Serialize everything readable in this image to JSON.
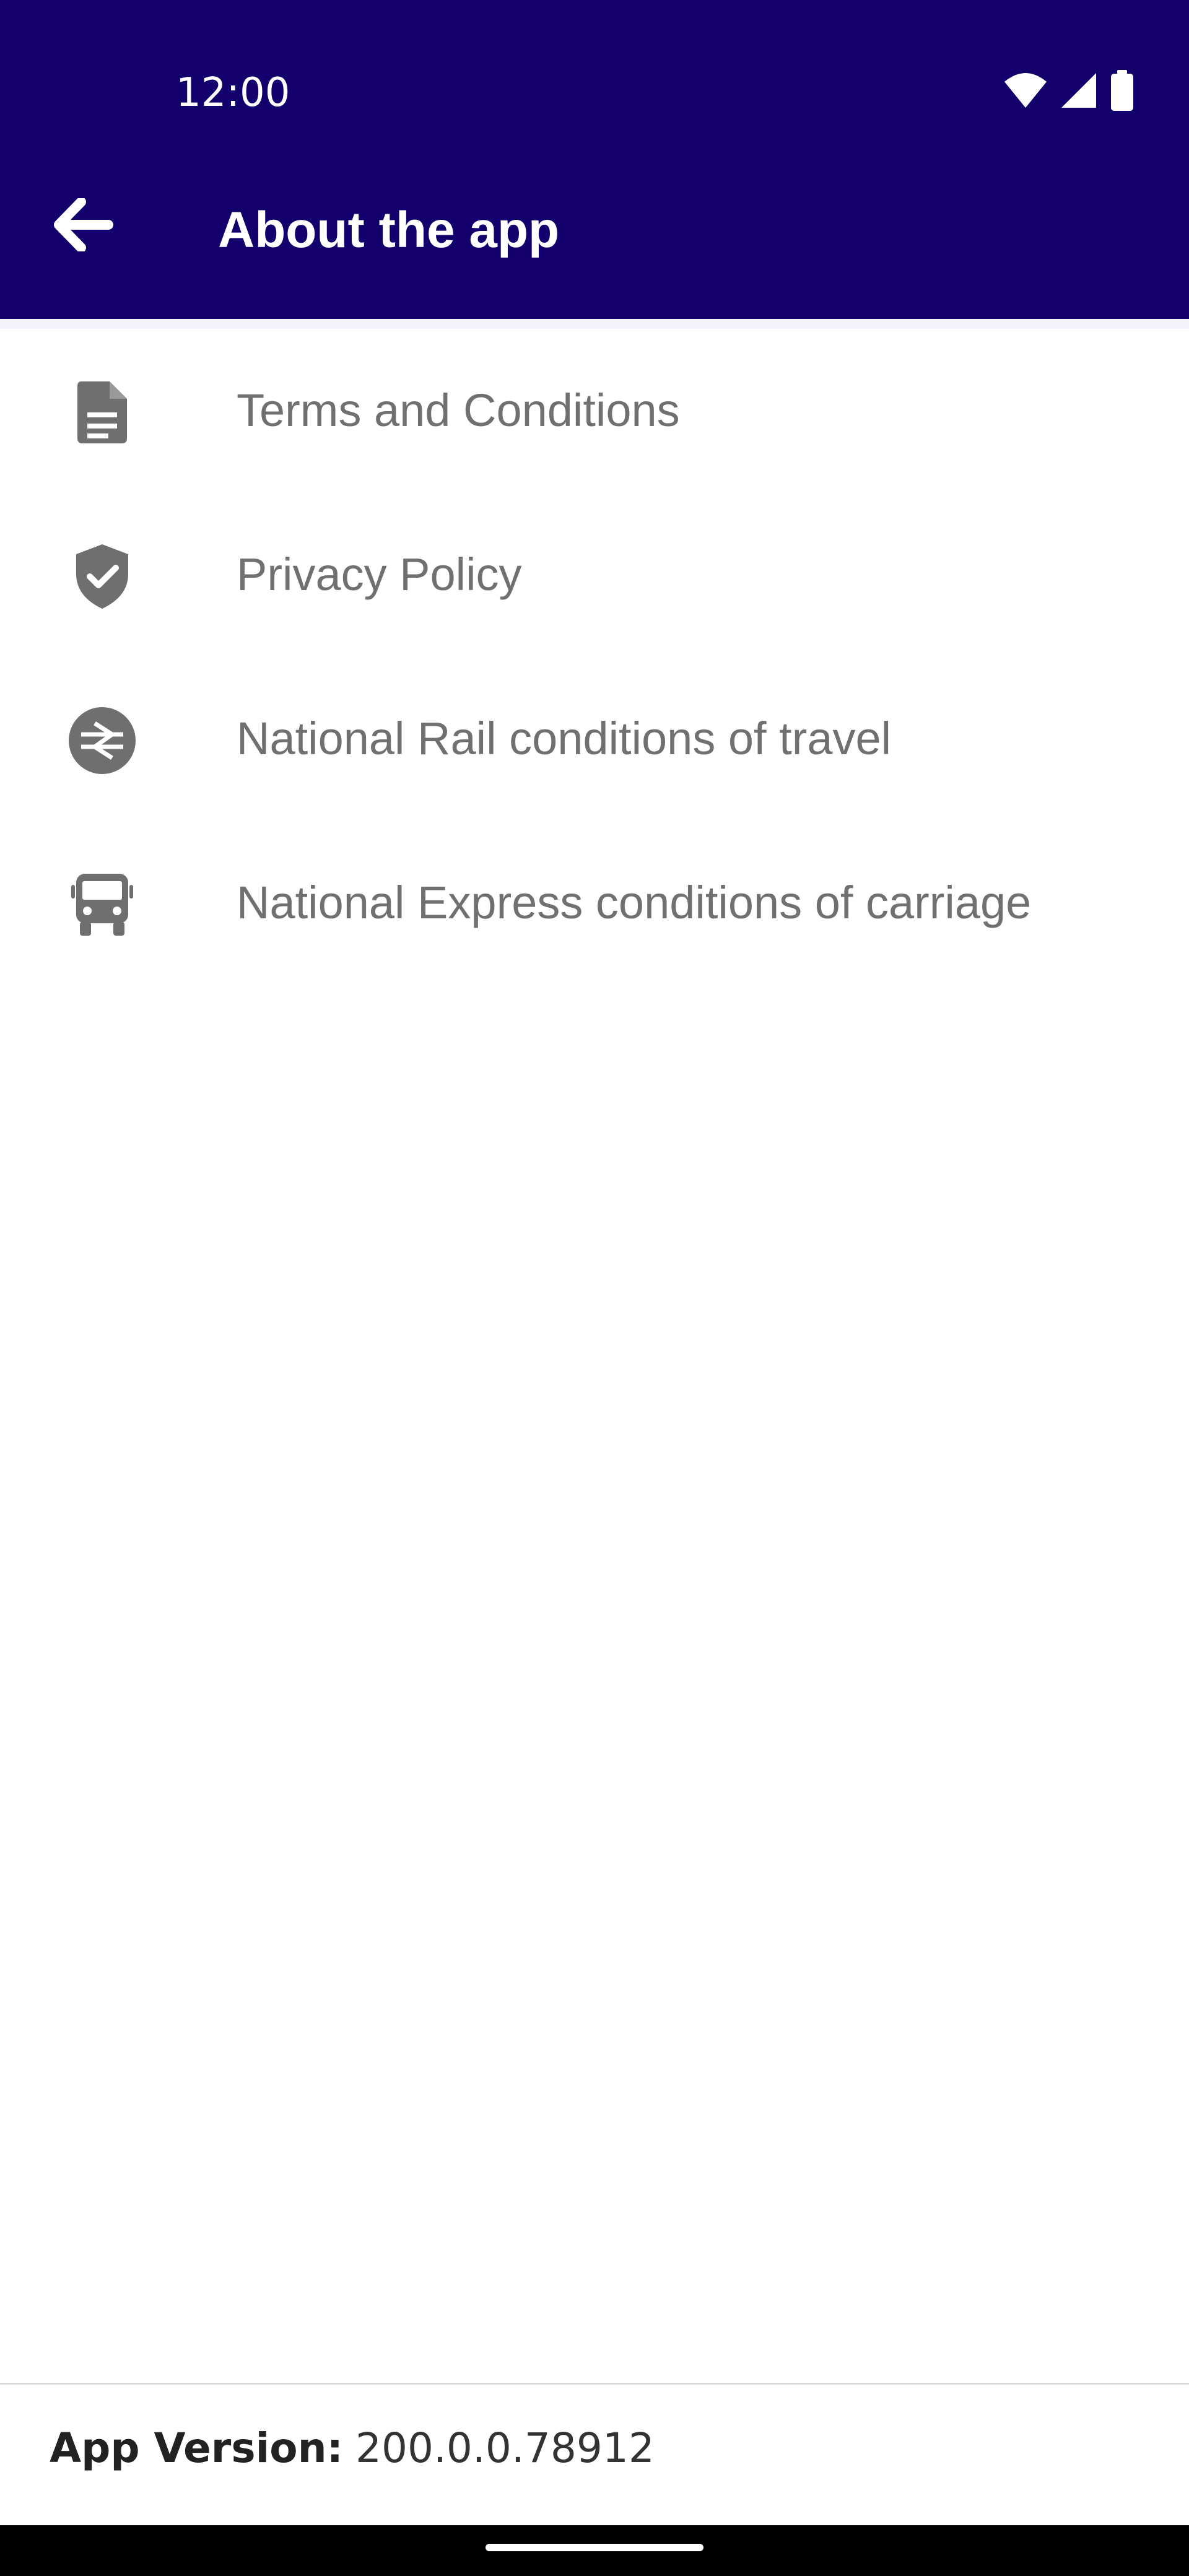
{
  "status_bar": {
    "time": "12:00",
    "icons": [
      "wifi-icon",
      "cellular-signal-icon",
      "battery-icon"
    ]
  },
  "header": {
    "back_icon": "arrow-back-icon",
    "title": "About the app",
    "background_color": "#13006d"
  },
  "menu": {
    "items": [
      {
        "label": "Terms and Conditions",
        "icon": "document-icon"
      },
      {
        "label": "Privacy Policy",
        "icon": "shield-check-icon"
      },
      {
        "label": "National Rail conditions of travel",
        "icon": "national-rail-icon"
      },
      {
        "label": "National Express conditions of carriage",
        "icon": "bus-icon"
      }
    ],
    "icon_color": "#6f6f6f",
    "text_color": "#707070"
  },
  "footer": {
    "version_label": "App Version:",
    "version_value": "200.0.0.78912"
  }
}
